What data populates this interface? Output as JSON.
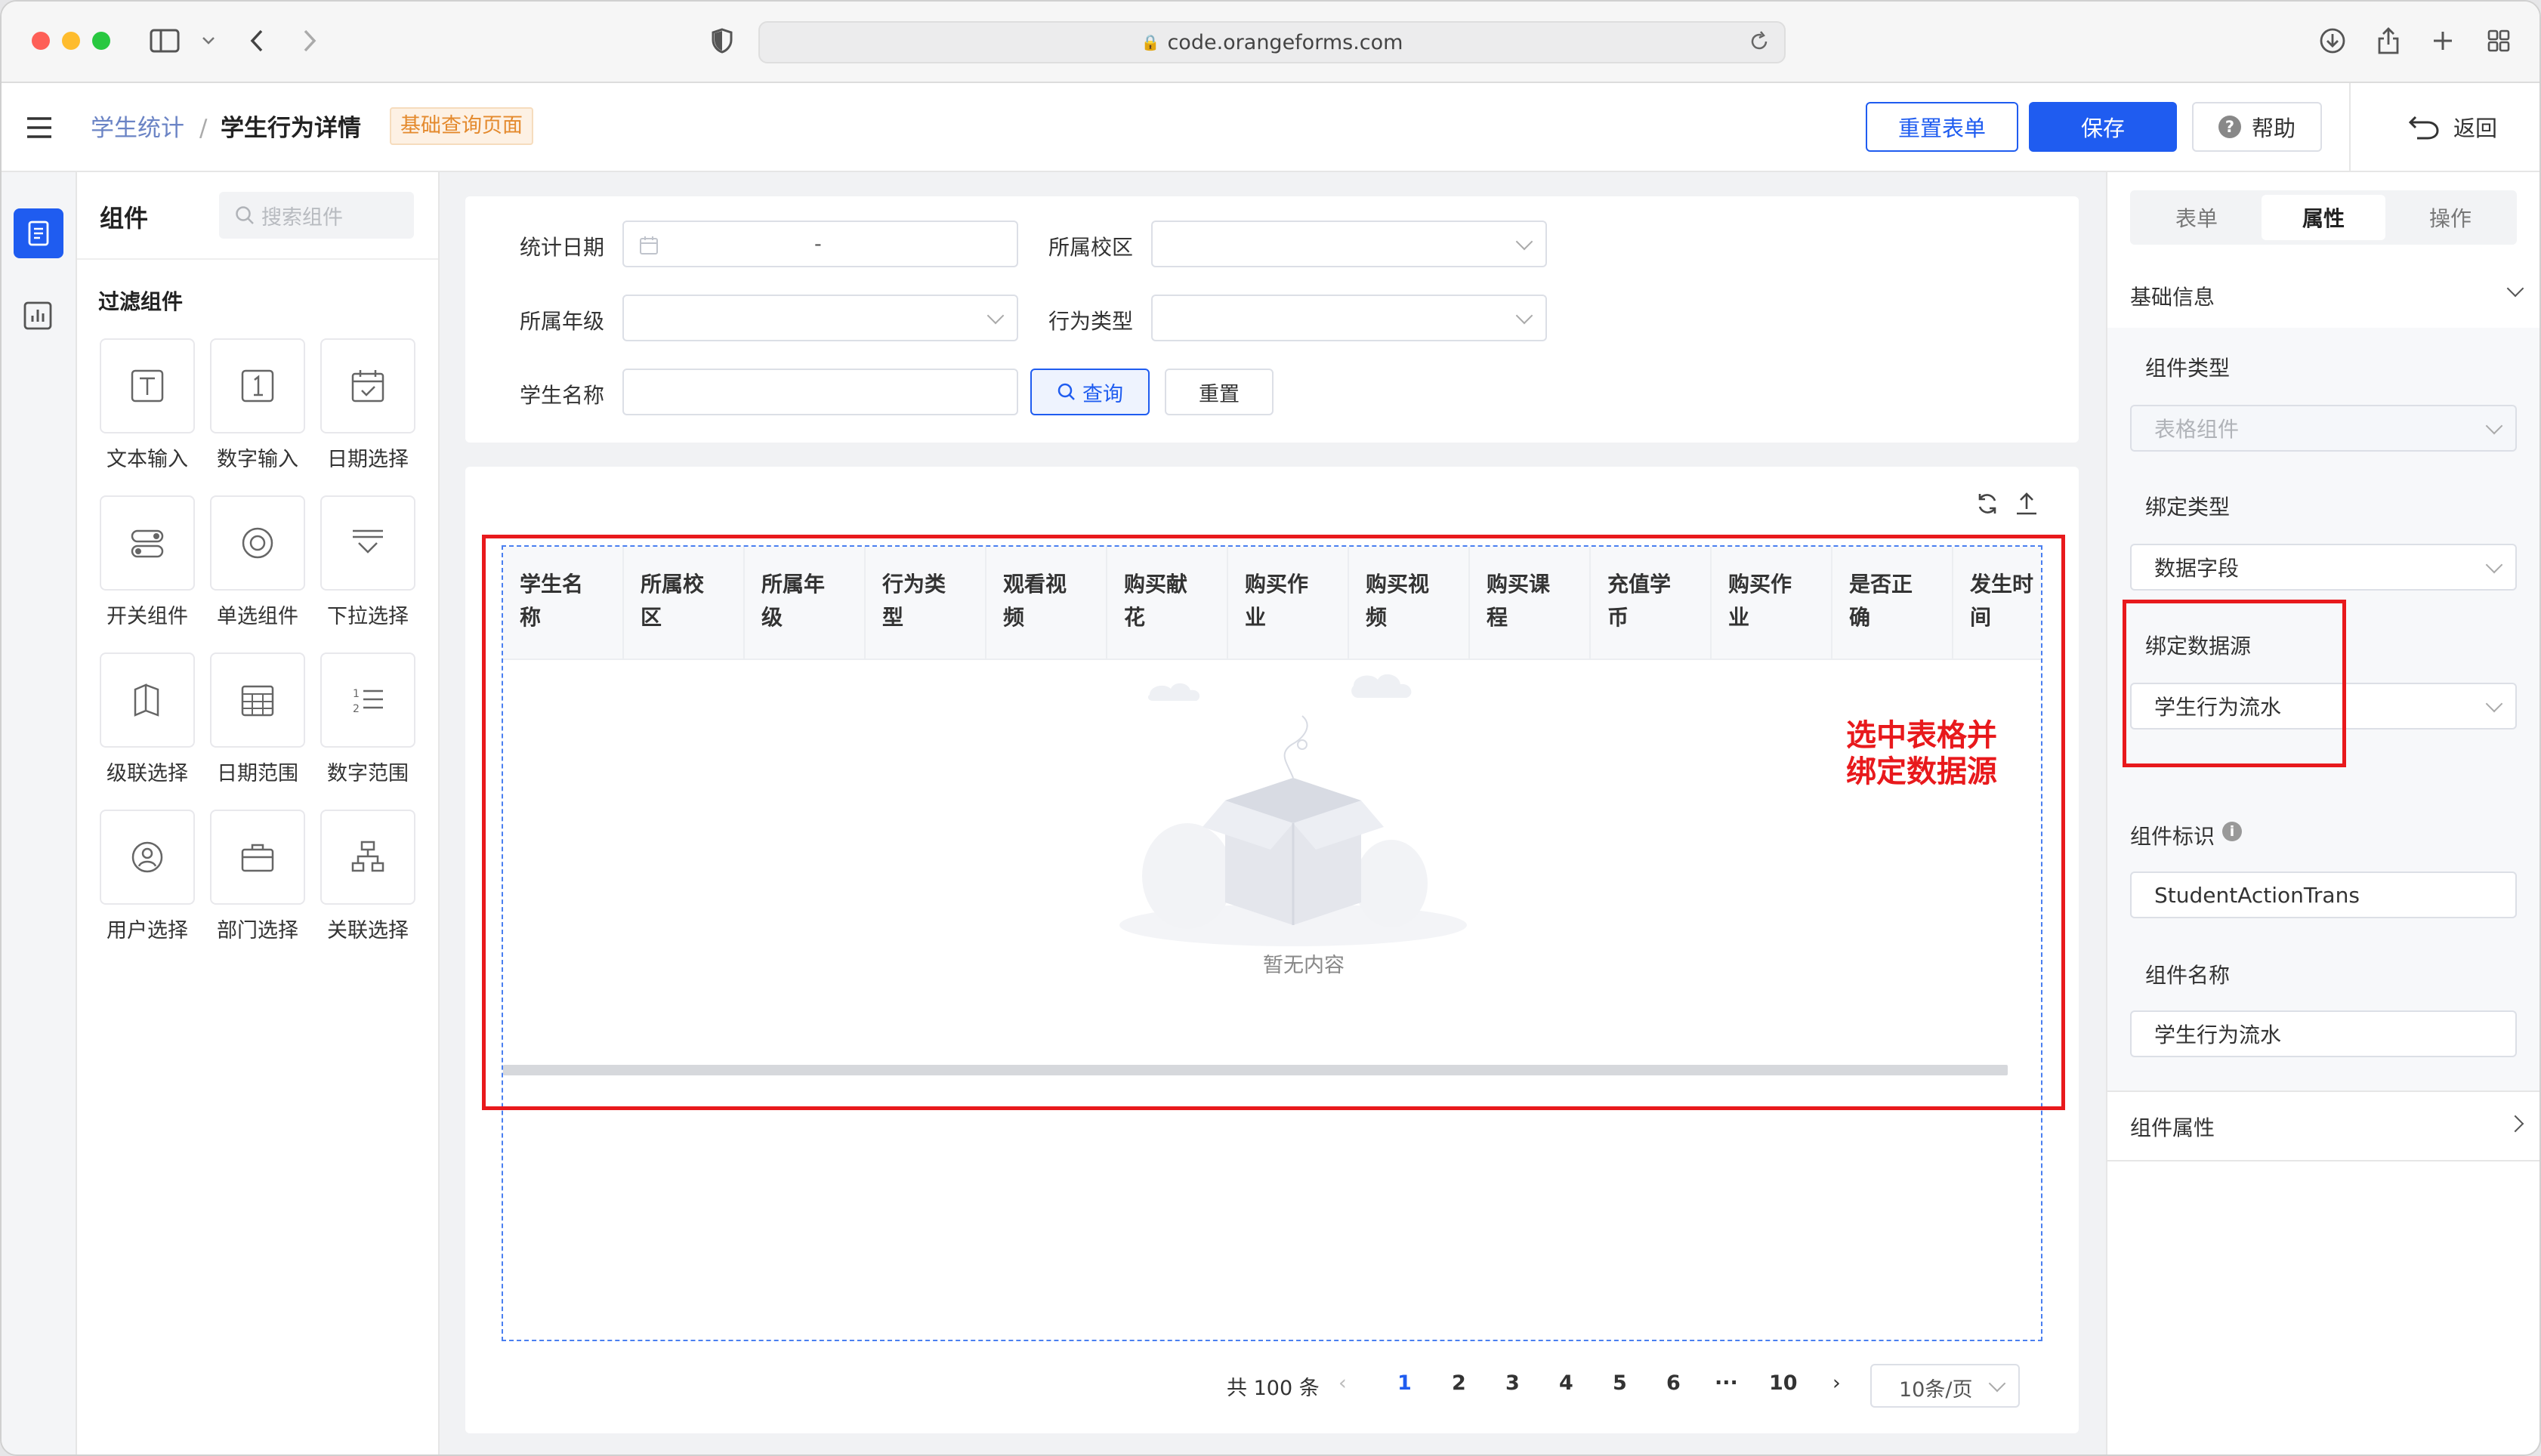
{
  "browser": {
    "url": "code.orangeforms.com"
  },
  "header": {
    "breadcrumb_parent": "学生统计",
    "breadcrumb_sep": "/",
    "breadcrumb_current": "学生行为详情",
    "page_tag": "基础查询页面",
    "reset_form": "重置表单",
    "save": "保存",
    "help": "帮助",
    "back": "返回"
  },
  "components": {
    "title": "组件",
    "search_placeholder": "搜索组件",
    "section_title": "过滤组件",
    "items": [
      {
        "label": "文本输入",
        "icon": "text-input-icon"
      },
      {
        "label": "数字输入",
        "icon": "number-input-icon"
      },
      {
        "label": "日期选择",
        "icon": "date-picker-icon"
      },
      {
        "label": "开关组件",
        "icon": "switch-icon"
      },
      {
        "label": "单选组件",
        "icon": "radio-icon"
      },
      {
        "label": "下拉选择",
        "icon": "select-icon"
      },
      {
        "label": "级联选择",
        "icon": "cascader-icon"
      },
      {
        "label": "日期范围",
        "icon": "date-range-icon"
      },
      {
        "label": "数字范围",
        "icon": "number-range-icon"
      },
      {
        "label": "用户选择",
        "icon": "user-select-icon"
      },
      {
        "label": "部门选择",
        "icon": "dept-select-icon"
      },
      {
        "label": "关联选择",
        "icon": "relation-select-icon"
      }
    ]
  },
  "filter": {
    "stat_date": "统计日期",
    "date_sep": "-",
    "campus": "所属校区",
    "grade": "所属年级",
    "action_type": "行为类型",
    "student_name": "学生名称",
    "query": "查询",
    "reset": "重置"
  },
  "table": {
    "columns": [
      "学生名\n称",
      "所属校\n区",
      "所属年\n级",
      "行为类\n型",
      "观看视\n频",
      "购买献\n花",
      "购买作\n业",
      "购买视\n频",
      "购买课\n程",
      "充值学\n币",
      "购买作\n业",
      "是否正\n确",
      "发生时\n间"
    ],
    "empty_text": "暂无内容",
    "annotation": "选中表格并\n绑定数据源"
  },
  "pagination": {
    "total": "共 100 条",
    "pages": [
      "1",
      "2",
      "3",
      "4",
      "5",
      "6",
      "···",
      "10"
    ],
    "current": "1",
    "page_size": "10条/页"
  },
  "props": {
    "tabs": [
      "表单",
      "属性",
      "操作"
    ],
    "active_tab": "属性",
    "basic_info": "基础信息",
    "comp_type_label": "组件类型",
    "comp_type_value": "表格组件",
    "bind_type_label": "绑定类型",
    "bind_type_value": "数据字段",
    "datasource_label": "绑定数据源",
    "datasource_value": "学生行为流水",
    "comp_id_label": "组件标识",
    "comp_id_value": "StudentActionTrans",
    "comp_name_label": "组件名称",
    "comp_name_value": "学生行为流水",
    "comp_props": "组件属性"
  },
  "colors": {
    "primary": "#1f5cf0",
    "highlight": "#e8191c",
    "tag_bg": "#fdf1e4",
    "tag_text": "#e48a2e"
  }
}
